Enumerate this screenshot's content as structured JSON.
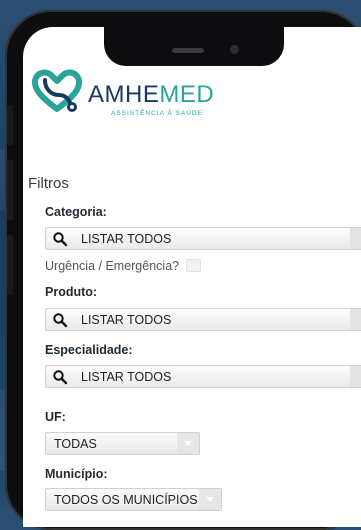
{
  "brand": {
    "name_part1": "AMHE",
    "name_part2": "MED",
    "tagline": "ASSISTÊNCIA À SAÚDE",
    "primary_color": "#173a63",
    "accent_color": "#2aa39a"
  },
  "filters": {
    "title": "Filtros",
    "categoria": {
      "label": "Categoria:",
      "value": "LISTAR TODOS"
    },
    "urgencia": {
      "label": "Urgência / Emergência?",
      "checked": false
    },
    "produto": {
      "label": "Produto:",
      "value": "LISTAR TODOS"
    },
    "especialidade": {
      "label": "Especialidade:",
      "value": "LISTAR TODOS"
    },
    "uf": {
      "label": "UF:",
      "value": "TODAS"
    },
    "municipio": {
      "label": "Município:",
      "value": "TODOS OS MUNICÍPIOS"
    }
  },
  "icons": {
    "search": "search-icon",
    "dropdown": "chevron-down-icon",
    "logo": "heart-stethoscope-icon"
  }
}
